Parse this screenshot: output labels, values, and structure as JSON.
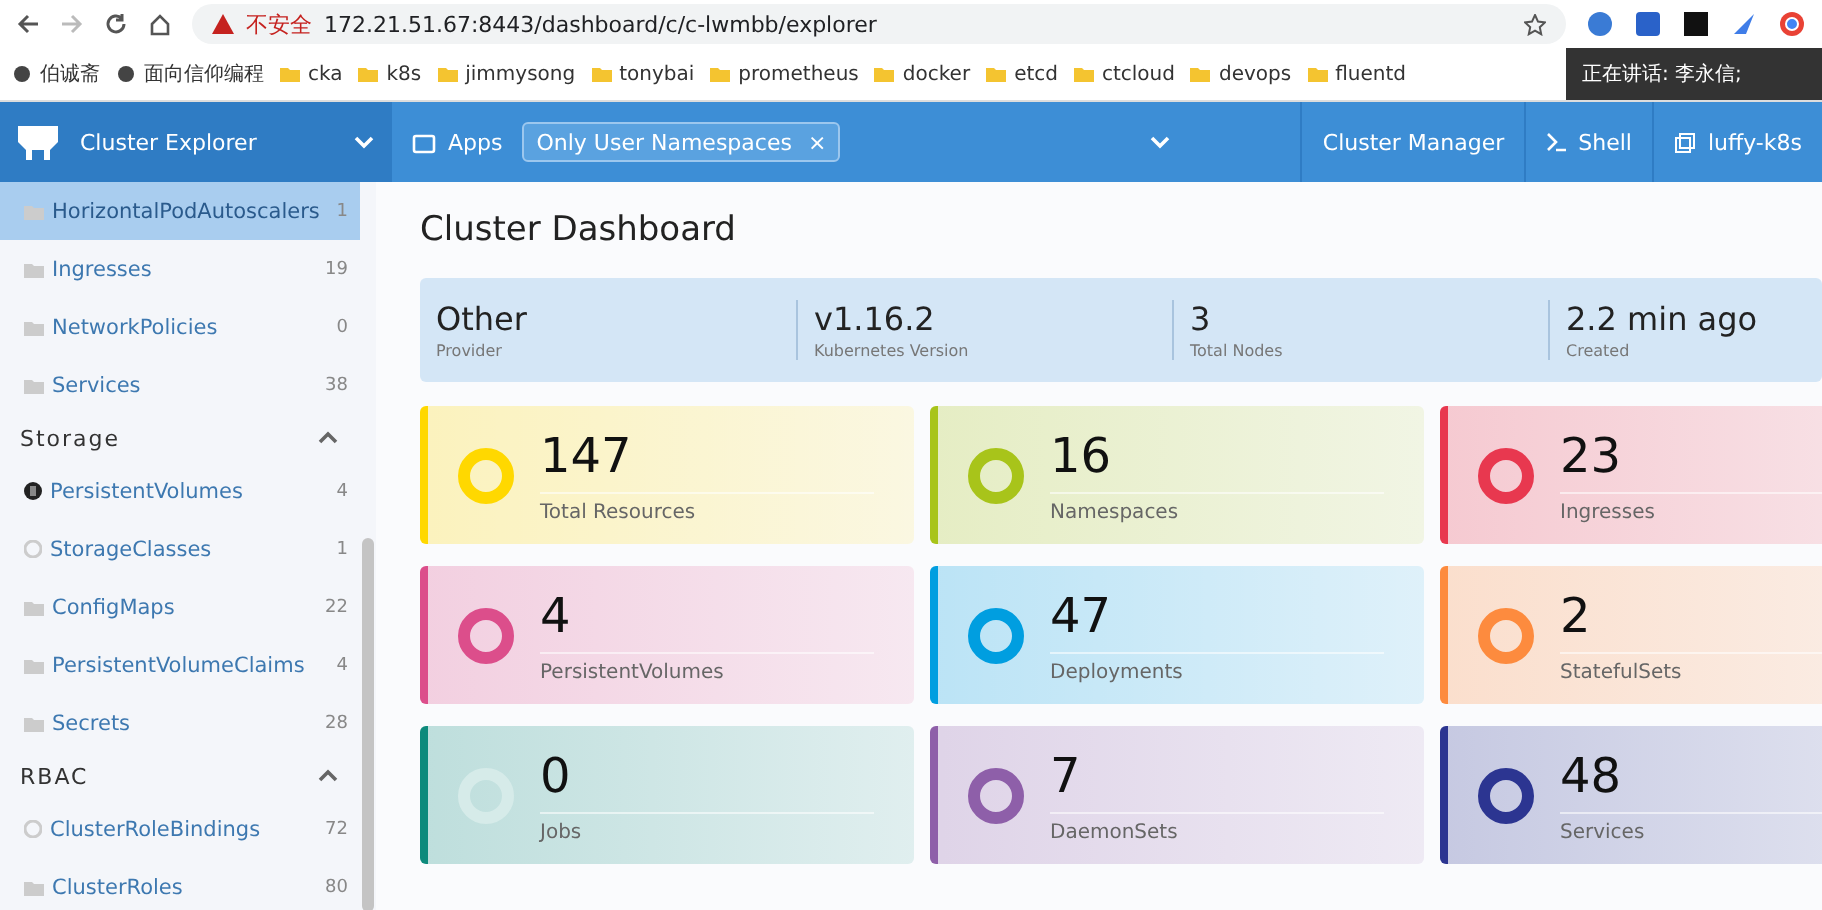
{
  "browser": {
    "security_label": "不安全",
    "url": "172.21.51.67:8443/dashboard/c/c-lwmbb/explorer",
    "bookmarks": [
      {
        "label": "伯诚斋",
        "kind": "site"
      },
      {
        "label": "面向信仰编程",
        "kind": "site"
      },
      {
        "label": "cka",
        "kind": "folder"
      },
      {
        "label": "k8s",
        "kind": "folder"
      },
      {
        "label": "jimmysong",
        "kind": "folder"
      },
      {
        "label": "tonybai",
        "kind": "folder"
      },
      {
        "label": "prometheus",
        "kind": "folder"
      },
      {
        "label": "docker",
        "kind": "folder"
      },
      {
        "label": "etcd",
        "kind": "folder"
      },
      {
        "label": "ctcloud",
        "kind": "folder"
      },
      {
        "label": "devops",
        "kind": "folder"
      },
      {
        "label": "fluentd",
        "kind": "folder"
      }
    ],
    "speaking_overlay": "正在讲话: 李永信;"
  },
  "header": {
    "product": "Cluster Explorer",
    "apps": "Apps",
    "namespace_filter": "Only User Namespaces",
    "namespace_remove": "×",
    "links": [
      "Cluster Manager",
      "Shell",
      "luffy-k8s"
    ]
  },
  "sidebar": {
    "sections": [
      {
        "items": [
          {
            "label": "HorizontalPodAutoscalers",
            "count": "1",
            "kind": "folder",
            "selected": true
          },
          {
            "label": "Ingresses",
            "count": "19",
            "kind": "folder",
            "selected": false
          },
          {
            "label": "NetworkPolicies",
            "count": "0",
            "kind": "folder",
            "selected": false
          },
          {
            "label": "Services",
            "count": "38",
            "kind": "folder",
            "selected": false
          }
        ]
      },
      {
        "title": "Storage",
        "expanded": true,
        "items": [
          {
            "label": "PersistentVolumes",
            "count": "4",
            "kind": "disk",
            "selected": false
          },
          {
            "label": "StorageClasses",
            "count": "1",
            "kind": "circle",
            "selected": false
          },
          {
            "label": "ConfigMaps",
            "count": "22",
            "kind": "folder",
            "selected": false
          },
          {
            "label": "PersistentVolumeClaims",
            "count": "4",
            "kind": "folder",
            "selected": false
          },
          {
            "label": "Secrets",
            "count": "28",
            "kind": "folder",
            "selected": false
          }
        ]
      },
      {
        "title": "RBAC",
        "expanded": true,
        "items": [
          {
            "label": "ClusterRoleBindings",
            "count": "72",
            "kind": "circle",
            "selected": false
          },
          {
            "label": "ClusterRoles",
            "count": "80",
            "kind": "folder",
            "selected": false
          }
        ]
      }
    ]
  },
  "page": {
    "title": "Cluster Dashboard",
    "summary": [
      {
        "value": "Other",
        "label": "Provider"
      },
      {
        "value": "v1.16.2",
        "label": "Kubernetes Version"
      },
      {
        "value": "3",
        "label": "Total Nodes"
      },
      {
        "value": "2.2 min ago",
        "label": "Created"
      }
    ],
    "cards": [
      {
        "count": "147",
        "label": "Total Resources",
        "color": "#ffd800",
        "empty": false
      },
      {
        "count": "16",
        "label": "Namespaces",
        "color": "#a8c41a",
        "empty": false
      },
      {
        "count": "23",
        "label": "Ingresses",
        "color": "#e8384f",
        "empty": false
      },
      {
        "count": "4",
        "label": "PersistentVolumes",
        "color": "#dc4e8b",
        "empty": false
      },
      {
        "count": "47",
        "label": "Deployments",
        "color": "#009ee0",
        "empty": false
      },
      {
        "count": "2",
        "label": "StatefulSets",
        "color": "#fd8b3e",
        "empty": false
      },
      {
        "count": "0",
        "label": "Jobs",
        "color": "#0d8a7c",
        "empty": true
      },
      {
        "count": "7",
        "label": "DaemonSets",
        "color": "#8e5fa9",
        "empty": false
      },
      {
        "count": "48",
        "label": "Services",
        "color": "#2c3591",
        "empty": false
      }
    ]
  }
}
